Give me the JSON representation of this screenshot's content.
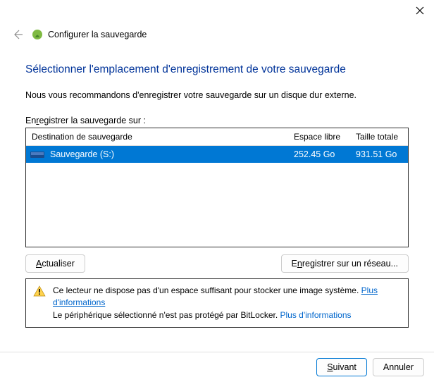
{
  "wizard_title": "Configurer la sauvegarde",
  "page_title": "Sélectionner l'emplacement d'enregistrement de votre sauvegarde",
  "recommendation": "Nous vous recommandons d'enregistrer votre sauvegarde sur un disque dur externe.",
  "save_on": {
    "prefix": "En",
    "underlined": "r",
    "suffix": "egistrer la sauvegarde sur :"
  },
  "table": {
    "headers": {
      "destination": "Destination de sauvegarde",
      "free": "Espace libre",
      "total": "Taille totale"
    },
    "rows": [
      {
        "name": "Sauvegarde (S:)",
        "free": "252.45 Go",
        "total": "931.51 Go",
        "selected": true
      }
    ]
  },
  "buttons": {
    "refresh_underlined": "A",
    "refresh_rest": "ctualiser",
    "network_prefix": "E",
    "network_underlined": "n",
    "network_suffix": "registrer sur un réseau...",
    "next_underlined": "S",
    "next_rest": "uivant",
    "cancel": "Annuler"
  },
  "warning": {
    "line1_text": "Ce lecteur ne dispose pas d'un espace suffisant pour stocker une image système. ",
    "line1_link": "Plus d'informations",
    "line2_text": "Le périphérique sélectionné n'est pas protégé par BitLocker. ",
    "line2_link": "Plus d'informations"
  }
}
